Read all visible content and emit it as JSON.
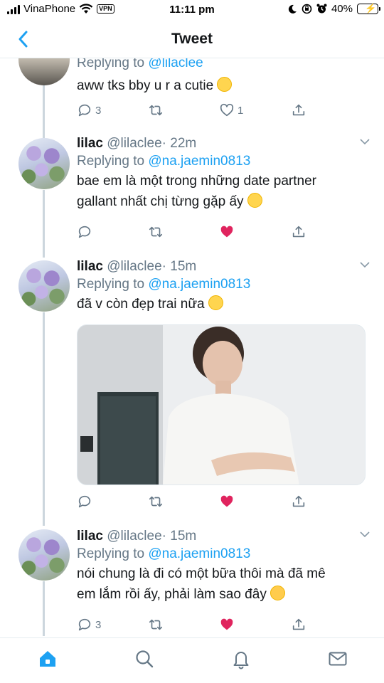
{
  "status_bar": {
    "carrier": "VinaPhone",
    "vpn_label": "VPN",
    "time": "11:11 pm",
    "battery": "40%",
    "battery_level": 0.4
  },
  "nav": {
    "title": "Tweet",
    "back_icon": "chevron-left-icon"
  },
  "tweets": [
    {
      "replying_prefix": "Replying to",
      "replying_to": "@lilaclee",
      "text": "aww tks bby u r a cutie",
      "emoji": "smiling-face-with-hearts",
      "replies": "3",
      "retweets": "",
      "likes": "1",
      "liked": false
    },
    {
      "name": "lilac",
      "handle": "@lilaclee",
      "time": "· 22m",
      "replying_prefix": "Replying to",
      "replying_to": "@na.jaemin0813",
      "text_line1": "bae em là một trong những date partner",
      "text_line2": "gallant nhất chị từng gặp ấy",
      "emoji": "pleading-face",
      "replies": "",
      "retweets": "",
      "likes": "",
      "liked": true
    },
    {
      "name": "lilac",
      "handle": "@lilaclee",
      "time": "· 15m",
      "replying_prefix": "Replying to",
      "replying_to": "@na.jaemin0813",
      "text": "đã v còn đẹp trai nữa",
      "emoji": "pleading-face",
      "has_photo": true,
      "replies": "",
      "retweets": "",
      "likes": "",
      "liked": true
    },
    {
      "name": "lilac",
      "handle": "@lilaclee",
      "time": "· 15m",
      "replying_prefix": "Replying to",
      "replying_to": "@na.jaemin0813",
      "text_line1": "nói chung là đi có một bữa thôi mà đã mê",
      "text_line2": "em lắm rồi ấy, phải làm sao đây",
      "emoji": "disappointed-face",
      "replies": "3",
      "retweets": "",
      "likes": "",
      "liked": true
    }
  ],
  "tab_bar": {
    "items": [
      "home-icon",
      "search-icon",
      "notifications-icon",
      "messages-icon"
    ],
    "active": "home-icon"
  },
  "colors": {
    "accent": "#1da1f2",
    "like": "#e0245e",
    "muted": "#657786",
    "thread_line": "#ccd6dd"
  }
}
